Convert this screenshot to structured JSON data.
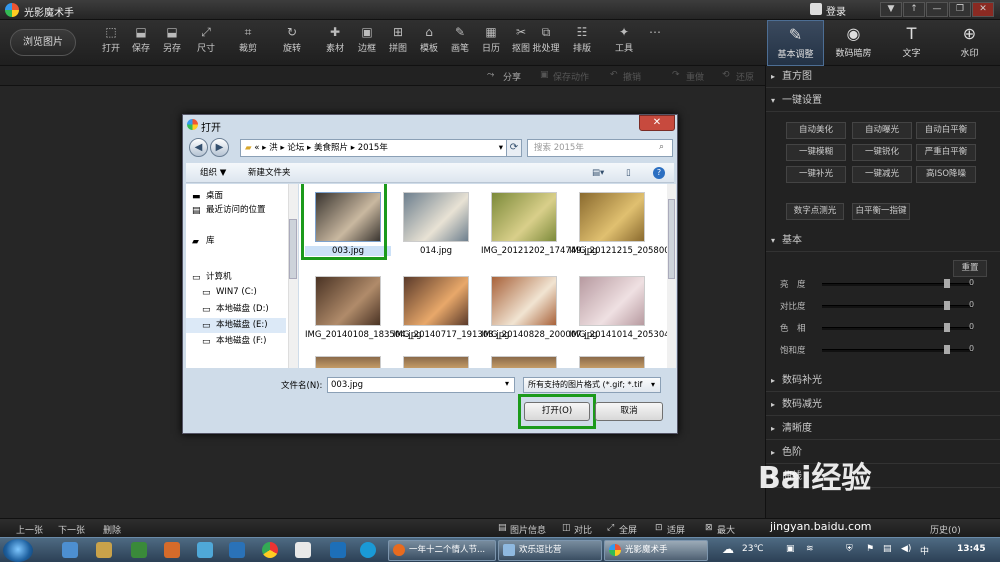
{
  "app": {
    "title": "光影魔术手",
    "login": "登录",
    "window_buttons": [
      "▼",
      "↑",
      "—",
      "❐",
      "✕"
    ]
  },
  "toolbar": {
    "browse": "浏览图片",
    "tools": [
      {
        "icon": "open-icon",
        "glyph": "⬚",
        "label": "打开"
      },
      {
        "icon": "save-icon",
        "glyph": "⬓",
        "label": "保存"
      },
      {
        "icon": "save-as-icon",
        "glyph": "⬓",
        "label": "另存"
      },
      {
        "icon": "resize-icon",
        "glyph": "⤢",
        "label": "尺寸"
      },
      {
        "icon": "crop-icon",
        "glyph": "⌗",
        "label": "裁剪"
      },
      {
        "icon": "rotate-icon",
        "glyph": "↻",
        "label": "旋转"
      },
      {
        "icon": "material-icon",
        "glyph": "✚",
        "label": "素材"
      },
      {
        "icon": "border-icon",
        "glyph": "▣",
        "label": "边框"
      },
      {
        "icon": "collage-icon",
        "glyph": "⊞",
        "label": "拼图"
      },
      {
        "icon": "template-icon",
        "glyph": "⌂",
        "label": "模板"
      },
      {
        "icon": "brush-icon",
        "glyph": "✎",
        "label": "画笔"
      },
      {
        "icon": "calendar-icon",
        "glyph": "▦",
        "label": "日历"
      },
      {
        "icon": "cutout-icon",
        "glyph": "✂",
        "label": "抠图"
      },
      {
        "icon": "batch-icon",
        "glyph": "⧉",
        "label": "批处理"
      },
      {
        "icon": "layout-icon",
        "glyph": "☷",
        "label": "排版"
      },
      {
        "icon": "tools-icon",
        "glyph": "✦",
        "label": "工具"
      },
      {
        "icon": "more-icon",
        "glyph": "⋯",
        "label": ""
      }
    ],
    "right_tabs": [
      {
        "icon": "basic-adjust-icon",
        "glyph": "✎",
        "label": "基本调整"
      },
      {
        "icon": "darkroom-icon",
        "glyph": "◉",
        "label": "数码暗房"
      },
      {
        "icon": "text-icon",
        "glyph": "T",
        "label": "文字"
      },
      {
        "icon": "watermark-icon",
        "glyph": "⊕",
        "label": "水印"
      }
    ]
  },
  "subbar": {
    "share": "分享",
    "save_action": "保存动作",
    "undo": "撤销",
    "redo": "重做",
    "restore": "还原"
  },
  "panel": {
    "histogram": "直方图",
    "one_click": "一键设置",
    "buttons": [
      "自动美化",
      "自动曝光",
      "自动白平衡",
      "一键模糊",
      "一键锐化",
      "严重白平衡",
      "一键补光",
      "一键减光",
      "高ISO降噪",
      "数字点测光",
      "白平衡一指键"
    ],
    "basic": "基本",
    "reset": "重置",
    "sliders": [
      {
        "label": "亮　度",
        "value": "0",
        "level": 0.5
      },
      {
        "label": "对比度",
        "value": "0",
        "level": 0.5
      },
      {
        "label": "色　相",
        "value": "0",
        "level": 0.5
      },
      {
        "label": "饱和度",
        "value": "0",
        "level": 0.5
      }
    ],
    "sections": [
      "数码补光",
      "数码减光",
      "清晰度",
      "色阶",
      "曲线"
    ]
  },
  "dialog": {
    "title": "打开",
    "close": "✕",
    "breadcrumb": [
      "«",
      "洪",
      "论坛",
      "美食照片",
      "2015年"
    ],
    "search_placeholder": "搜索 2015年",
    "organize": "组织 ▼",
    "new_folder": "新建文件夹",
    "nav": [
      {
        "icon": "desktop-icon",
        "glyph": "▬",
        "label": "桌面"
      },
      {
        "icon": "recent-icon",
        "glyph": "▤",
        "label": "最近访问的位置"
      },
      {
        "icon": "library-icon",
        "glyph": "▰",
        "label": "库"
      },
      {
        "icon": "computer-icon",
        "glyph": "▭",
        "label": "计算机"
      },
      {
        "icon": "drive-icon",
        "glyph": "▭",
        "label": "WIN7 (C:)"
      },
      {
        "icon": "drive-icon",
        "glyph": "▭",
        "label": "本地磁盘 (D:)"
      },
      {
        "icon": "drive-icon",
        "glyph": "▭",
        "label": "本地磁盘 (E:)"
      },
      {
        "icon": "drive-icon",
        "glyph": "▭",
        "label": "本地磁盘 (F:)"
      }
    ],
    "files": [
      {
        "name": "003.jpg",
        "c1": "#3a3530",
        "c2": "#c9b8a0"
      },
      {
        "name": "014.jpg",
        "c1": "#6d7f8e",
        "c2": "#e8e2d4"
      },
      {
        "name": "IMG_20121202_174749.jpg",
        "c1": "#7c8a3a",
        "c2": "#d9cf8a"
      },
      {
        "name": "IMG_20121215_205800.jpg",
        "c1": "#8a6a2e",
        "c2": "#e0c070"
      },
      {
        "name": "IMG_20140108_183504.jpg",
        "c1": "#4a3324",
        "c2": "#b08b6a"
      },
      {
        "name": "IMG_20140717_191303.jpg",
        "c1": "#5a3a2a",
        "c2": "#e8a86a"
      },
      {
        "name": "IMG_20140828_200007.jpg",
        "c1": "#a8623a",
        "c2": "#f1e4d2"
      },
      {
        "name": "IMG_20141014_205304.jpg",
        "c1": "#b79aa0",
        "c2": "#efe0e2"
      }
    ],
    "filename_label": "文件名(N):",
    "filename_value": "003.jpg",
    "filter": "所有支持的图片格式 (*.gif; *.tif",
    "open": "打开(O)",
    "cancel": "取消"
  },
  "statusbar": {
    "prev": "上一张",
    "next": "下一张",
    "delete": "删除",
    "info": "图片信息",
    "compare": "对比",
    "fullscreen": "全屏",
    "fit": "适屏",
    "max": "最大",
    "history": "历史(0)"
  },
  "taskbar": {
    "tasks": [
      "一年十二个情人节...",
      "欢乐逗比营",
      "光影魔术手"
    ],
    "weather": "23℃",
    "clock": "13:45"
  },
  "watermark": {
    "brand": "Bai经验",
    "url": "jingyan.baidu.com"
  }
}
